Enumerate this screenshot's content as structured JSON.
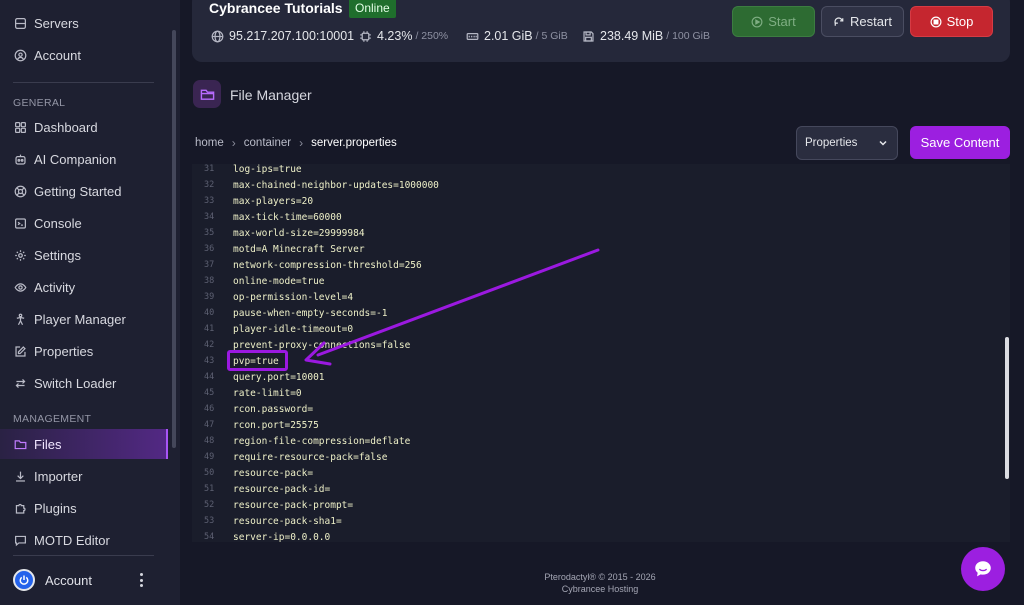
{
  "sidebar": {
    "top_items": [
      {
        "label": "Servers",
        "icon": "server-icon"
      },
      {
        "label": "Account",
        "icon": "user-circle-icon"
      }
    ],
    "general_heading": "GENERAL",
    "general_items": [
      {
        "label": "Dashboard",
        "icon": "dashboard-icon"
      },
      {
        "label": "AI Companion",
        "icon": "robot-icon"
      },
      {
        "label": "Getting Started",
        "icon": "lifebuoy-icon"
      },
      {
        "label": "Console",
        "icon": "terminal-icon"
      },
      {
        "label": "Settings",
        "icon": "gear-icon"
      },
      {
        "label": "Activity",
        "icon": "eye-icon"
      },
      {
        "label": "Player Manager",
        "icon": "person-icon"
      },
      {
        "label": "Properties",
        "icon": "edit-icon"
      },
      {
        "label": "Switch Loader",
        "icon": "swap-icon"
      }
    ],
    "management_heading": "MANAGEMENT",
    "management_items": [
      {
        "label": "Files",
        "icon": "folder-icon",
        "active": true
      },
      {
        "label": "Importer",
        "icon": "download-icon"
      },
      {
        "label": "Plugins",
        "icon": "puzzle-icon"
      },
      {
        "label": "MOTD Editor",
        "icon": "chat-icon"
      }
    ],
    "account_label": "Account"
  },
  "server": {
    "name": "Cybrancee Tutorials",
    "status": "Online",
    "address": "95.217.207.100:10001",
    "cpu": "4.23%",
    "cpu_limit": "/ 250%",
    "memory": "2.01 GiB",
    "memory_limit": "/ 5 GiB",
    "disk": "238.49 MiB",
    "disk_limit": "/ 100 GiB"
  },
  "power": {
    "start_label": "Start",
    "restart_label": "Restart",
    "stop_label": "Stop"
  },
  "file_manager": {
    "title": "File Manager",
    "breadcrumb": [
      "home",
      "container",
      "server.properties"
    ],
    "mode_select": "Properties",
    "save_label": "Save Content"
  },
  "editor": {
    "lines": [
      {
        "n": "31",
        "text": "log-ips=true"
      },
      {
        "n": "32",
        "text": "max-chained-neighbor-updates=1000000"
      },
      {
        "n": "33",
        "text": "max-players=20"
      },
      {
        "n": "34",
        "text": "max-tick-time=60000"
      },
      {
        "n": "35",
        "text": "max-world-size=29999984"
      },
      {
        "n": "36",
        "text": "motd=A Minecraft Server"
      },
      {
        "n": "37",
        "text": "network-compression-threshold=256"
      },
      {
        "n": "38",
        "text": "online-mode=true"
      },
      {
        "n": "39",
        "text": "op-permission-level=4"
      },
      {
        "n": "40",
        "text": "pause-when-empty-seconds=-1"
      },
      {
        "n": "41",
        "text": "player-idle-timeout=0"
      },
      {
        "n": "42",
        "text": "prevent-proxy-connections=false"
      },
      {
        "n": "43",
        "text": "pvp=true"
      },
      {
        "n": "44",
        "text": "query.port=10001"
      },
      {
        "n": "45",
        "text": "rate-limit=0"
      },
      {
        "n": "46",
        "text": "rcon.password="
      },
      {
        "n": "47",
        "text": "rcon.port=25575"
      },
      {
        "n": "48",
        "text": "region-file-compression=deflate"
      },
      {
        "n": "49",
        "text": "require-resource-pack=false"
      },
      {
        "n": "50",
        "text": "resource-pack="
      },
      {
        "n": "51",
        "text": "resource-pack-id="
      },
      {
        "n": "52",
        "text": "resource-pack-prompt="
      },
      {
        "n": "53",
        "text": "resource-pack-sha1="
      },
      {
        "n": "54",
        "text": "server-ip=0.0.0.0"
      }
    ]
  },
  "footer": {
    "line1": "Pterodactyl® © 2015 - 2026",
    "line2": "Cybrancee Hosting"
  },
  "colors": {
    "accent": "#9c1fe0",
    "online": "#1f6e2c",
    "stop": "#c5262f",
    "start": "#2d6b32"
  }
}
